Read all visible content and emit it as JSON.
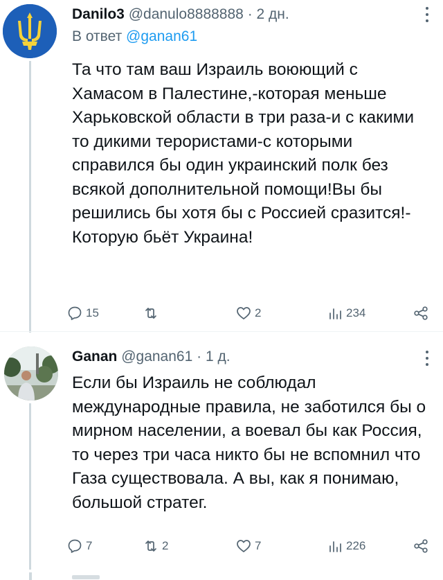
{
  "tweets": [
    {
      "name": "Danilo3",
      "handle": "@danulo8888888",
      "time": "2 дн.",
      "reply_prefix": "В ответ",
      "reply_to": "@ganan61",
      "text": "Та что там ваш Израиль воюющий с Хамасом в Палестине,-которая меньше Харьковской области в три раза-и с какими то дикими терористами-с которыми справился бы один украинский полк без всякой дополнительной помощи!Вы бы решились бы хотя бы с Россией сразится!-Которую бьёт Украина!",
      "replies": "15",
      "reposts": "",
      "likes": "2",
      "views": "234",
      "avatar_icon": "trident-coat-of-arms-icon",
      "avatar_color": "#1d5fb8",
      "avatar_accent": "#f5d23a"
    },
    {
      "name": "Ganan",
      "handle": "@ganan61",
      "time": "1 д.",
      "text": "Если бы Израиль не соблюдал международные правила, не заботился бы о мирном населении, а воевал бы как Россия, то через три часа никто бы не вспомнил что Газа существовала. А вы, как я понимаю, большой стратег.",
      "replies": "7",
      "reposts": "2",
      "likes": "7",
      "views": "226",
      "avatar_icon": "person-photo-icon"
    }
  ],
  "separator_dot": "·",
  "colors": {
    "text": "#0f1419",
    "secondary": "#536471",
    "link": "#1d9bf0",
    "thread_line": "#cfd9de"
  }
}
